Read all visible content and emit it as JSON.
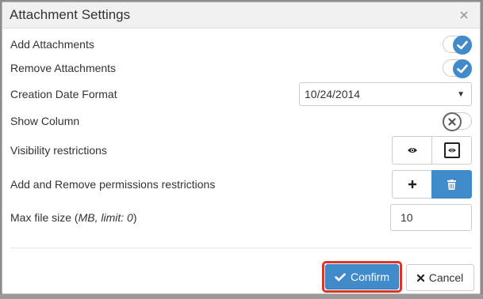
{
  "dialog": {
    "title": "Attachment Settings",
    "close_glyph": "×"
  },
  "settings": {
    "add_attachments": {
      "label": "Add Attachments",
      "enabled": true
    },
    "remove_attachments": {
      "label": "Remove Attachments",
      "enabled": true
    },
    "creation_date_format": {
      "label": "Creation Date Format",
      "value": "10/24/2014"
    },
    "show_column": {
      "label": "Show Column",
      "enabled": false
    },
    "visibility_restrictions": {
      "label": "Visibility restrictions",
      "icons": [
        "eye-icon",
        "eye-boxed-icon"
      ]
    },
    "add_remove_permissions": {
      "label": "Add and Remove permissions restrictions",
      "icons": [
        "plus-icon",
        "trash-icon"
      ]
    },
    "max_file_size": {
      "label_prefix": "Max file size (",
      "label_em": "MB, limit: 0",
      "label_suffix": ")",
      "value": "10"
    }
  },
  "footer": {
    "confirm_label": "Confirm",
    "cancel_label": "Cancel"
  },
  "colors": {
    "primary": "#428bca",
    "highlight_border": "#d9362b"
  }
}
